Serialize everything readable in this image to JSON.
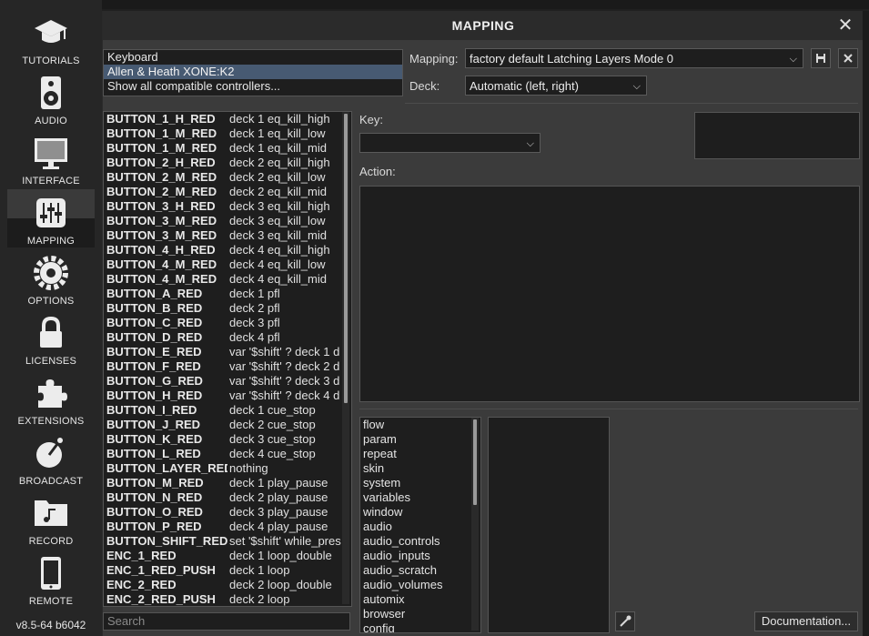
{
  "sidebar": {
    "items": [
      {
        "label": "TUTORIALS",
        "icon": "graduation-cap-icon"
      },
      {
        "label": "AUDIO",
        "icon": "speaker-icon"
      },
      {
        "label": "INTERFACE",
        "icon": "monitor-icon"
      },
      {
        "label": "MAPPING",
        "icon": "sliders-icon",
        "active": true
      },
      {
        "label": "OPTIONS",
        "icon": "gear-icon"
      },
      {
        "label": "LICENSES",
        "icon": "lock-icon"
      },
      {
        "label": "EXTENSIONS",
        "icon": "puzzle-icon"
      },
      {
        "label": "BROADCAST",
        "icon": "satellite-dish-icon"
      },
      {
        "label": "RECORD",
        "icon": "music-folder-icon"
      },
      {
        "label": "REMOTE",
        "icon": "smartphone-icon"
      }
    ],
    "version": "v8.5-64 b6042"
  },
  "dialog": {
    "title": "MAPPING",
    "close_label": "✕"
  },
  "controllers": {
    "items": [
      {
        "label": "Keyboard",
        "selected": false
      },
      {
        "label": "Allen & Heath XONE:K2",
        "selected": true
      },
      {
        "label": "Show all compatible controllers...",
        "selected": false
      }
    ]
  },
  "mapping": {
    "label": "Mapping:",
    "value": "factory default Latching Layers Mode 0"
  },
  "deck": {
    "label": "Deck:",
    "value": "Automatic (left, right)"
  },
  "key_label": "Key:",
  "action_label": "Action:",
  "search_placeholder": "Search",
  "documentation_label": "Documentation...",
  "table": [
    {
      "key": "BUTTON_1_H_RED",
      "action": "deck 1 eq_kill_high"
    },
    {
      "key": "BUTTON_1_M_RED",
      "action": "deck 1 eq_kill_low"
    },
    {
      "key": "BUTTON_1_M_RED",
      "action": "deck 1 eq_kill_mid"
    },
    {
      "key": "BUTTON_2_H_RED",
      "action": "deck 2 eq_kill_high"
    },
    {
      "key": "BUTTON_2_M_RED",
      "action": "deck 2 eq_kill_low"
    },
    {
      "key": "BUTTON_2_M_RED",
      "action": "deck 2 eq_kill_mid"
    },
    {
      "key": "BUTTON_3_H_RED",
      "action": "deck 3 eq_kill_high"
    },
    {
      "key": "BUTTON_3_M_RED",
      "action": "deck 3 eq_kill_low"
    },
    {
      "key": "BUTTON_3_M_RED",
      "action": "deck 3 eq_kill_mid"
    },
    {
      "key": "BUTTON_4_H_RED",
      "action": "deck 4 eq_kill_high"
    },
    {
      "key": "BUTTON_4_M_RED",
      "action": "deck 4 eq_kill_low"
    },
    {
      "key": "BUTTON_4_M_RED",
      "action": "deck 4 eq_kill_mid"
    },
    {
      "key": "BUTTON_A_RED",
      "action": "deck 1 pfl"
    },
    {
      "key": "BUTTON_B_RED",
      "action": "deck 2 pfl"
    },
    {
      "key": "BUTTON_C_RED",
      "action": "deck 3 pfl"
    },
    {
      "key": "BUTTON_D_RED",
      "action": "deck 4 pfl"
    },
    {
      "key": "BUTTON_E_RED",
      "action": "var '$shift' ? deck 1 d"
    },
    {
      "key": "BUTTON_F_RED",
      "action": "var '$shift' ? deck 2 d"
    },
    {
      "key": "BUTTON_G_RED",
      "action": "var '$shift' ? deck 3 d"
    },
    {
      "key": "BUTTON_H_RED",
      "action": "var '$shift' ? deck 4 d"
    },
    {
      "key": "BUTTON_I_RED",
      "action": "deck 1 cue_stop"
    },
    {
      "key": "BUTTON_J_RED",
      "action": "deck 2 cue_stop"
    },
    {
      "key": "BUTTON_K_RED",
      "action": "deck 3 cue_stop"
    },
    {
      "key": "BUTTON_L_RED",
      "action": "deck 4 cue_stop"
    },
    {
      "key": "BUTTON_LAYER_RED",
      "action": "nothing"
    },
    {
      "key": "BUTTON_M_RED",
      "action": "deck 1 play_pause"
    },
    {
      "key": "BUTTON_N_RED",
      "action": "deck 2 play_pause"
    },
    {
      "key": "BUTTON_O_RED",
      "action": "deck 3 play_pause"
    },
    {
      "key": "BUTTON_P_RED",
      "action": "deck 4 play_pause"
    },
    {
      "key": "BUTTON_SHIFT_RED",
      "action": "set '$shift' while_pres"
    },
    {
      "key": "ENC_1_RED",
      "action": "deck 1 loop_double"
    },
    {
      "key": "ENC_1_RED_PUSH",
      "action": "deck 1 loop"
    },
    {
      "key": "ENC_2_RED",
      "action": "deck 2 loop_double"
    },
    {
      "key": "ENC_2_RED_PUSH",
      "action": "deck 2 loop"
    }
  ],
  "commands": [
    "flow",
    "param",
    "repeat",
    "skin",
    "system",
    "variables",
    "window",
    "audio",
    "audio_controls",
    "audio_inputs",
    "audio_scratch",
    "audio_volumes",
    "automix",
    "browser",
    "config"
  ]
}
